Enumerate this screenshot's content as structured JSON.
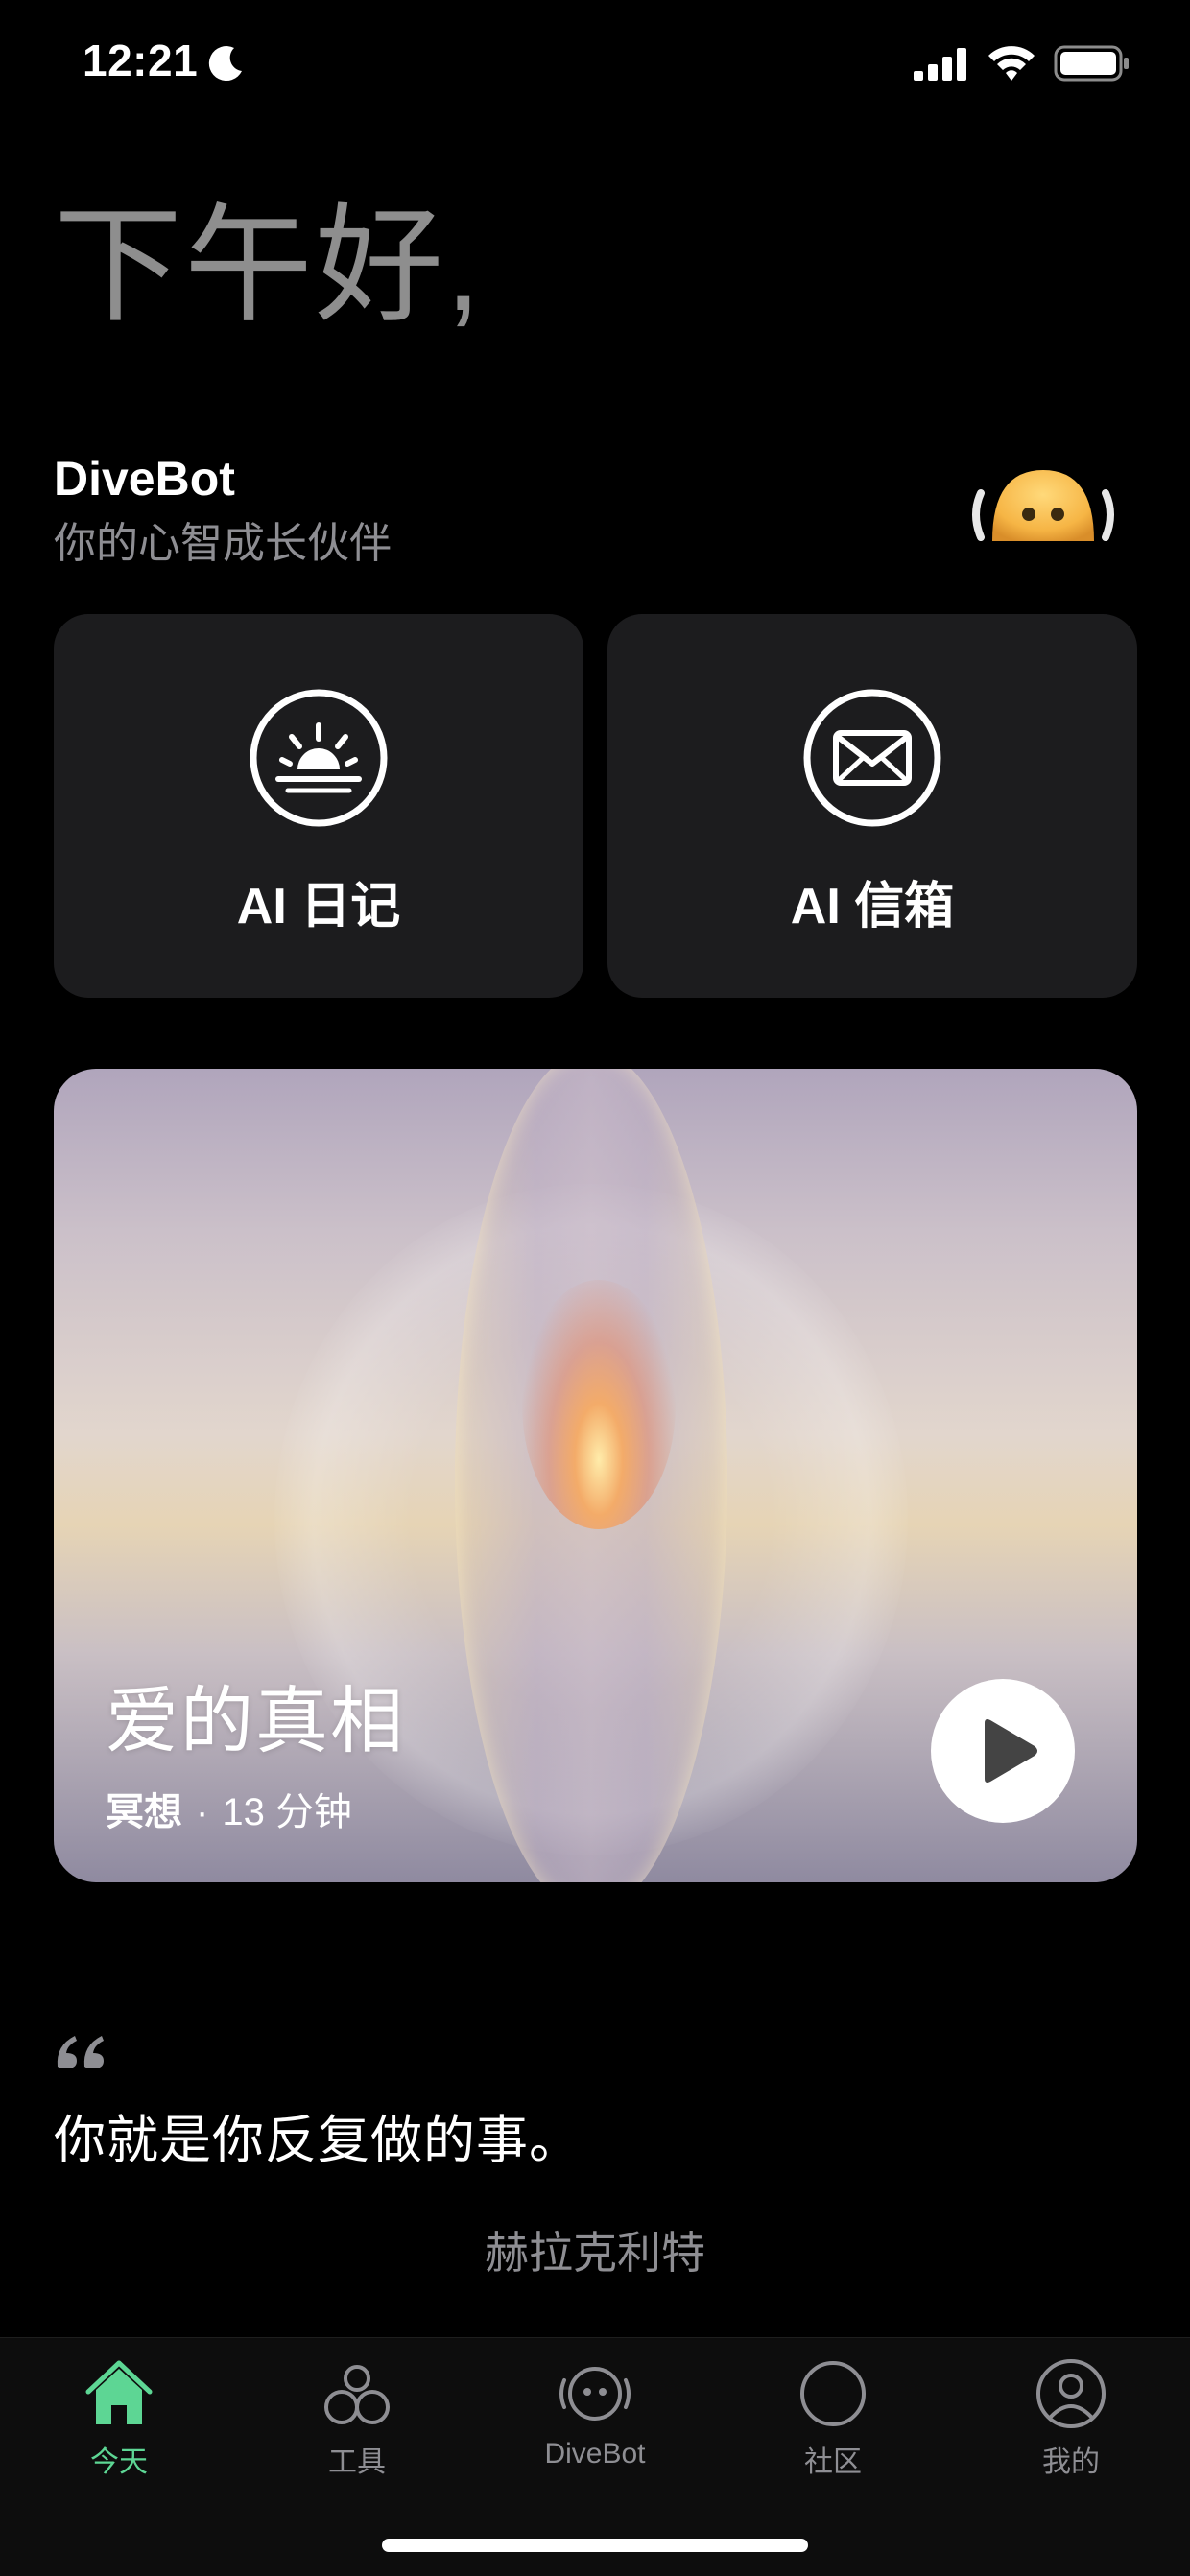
{
  "status_bar": {
    "time": "12:21",
    "icons": [
      "moon-icon",
      "signal-icon",
      "wifi-icon",
      "battery-icon"
    ]
  },
  "greeting": "下午好,",
  "bot": {
    "name": "DiveBot",
    "tagline": "你的心智成长伙伴",
    "avatar_icon": "bot-face-icon"
  },
  "features": [
    {
      "label": "AI 日记",
      "icon": "sunrise-icon"
    },
    {
      "label": "AI 信箱",
      "icon": "envelope-icon"
    }
  ],
  "meditation": {
    "title": "爱的真相",
    "category": "冥想",
    "separator": "·",
    "duration": "13 分钟",
    "action_icon": "play-icon"
  },
  "quote": {
    "text": "你就是你反复做的事。",
    "author": "赫拉克利特"
  },
  "tab_bar": {
    "items": [
      {
        "label": "今天",
        "icon": "home-icon",
        "active": true
      },
      {
        "label": "工具",
        "icon": "tools-icon",
        "active": false
      },
      {
        "label": "DiveBot",
        "icon": "divebot-icon",
        "active": false
      },
      {
        "label": "社区",
        "icon": "community-icon",
        "active": false
      },
      {
        "label": "我的",
        "icon": "profile-icon",
        "active": false
      }
    ]
  },
  "colors": {
    "background": "#000000",
    "card": "#1c1c1e",
    "accent": "#5dd694",
    "secondary_text": "#8e8e93"
  }
}
